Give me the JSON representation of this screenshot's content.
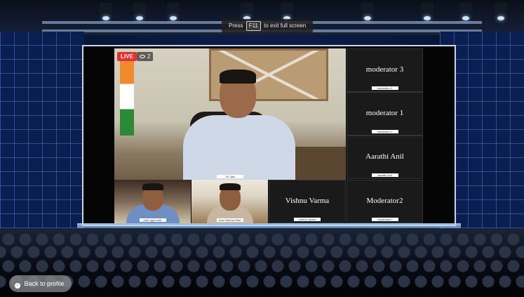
{
  "overlay": {
    "press_label": "Press",
    "key_label": "F11",
    "exit_label": "to exit full screen"
  },
  "main_video": {
    "live_badge": "LIVE",
    "viewer_count": "2",
    "viewer_icon": "eye-icon",
    "name_tag": "YK Jain"
  },
  "tiles": [
    {
      "name": "moderator 3",
      "tag": "moderator 3"
    },
    {
      "name": "moderator 1",
      "tag": "moderator 1"
    },
    {
      "name": "Aarathi Anil",
      "tag": "Aarathi Anil"
    },
    {
      "name": "Vishnu Varma",
      "tag": "Vishnu Varma"
    },
    {
      "name": "Moderator2",
      "tag": "Moderator2"
    }
  ],
  "cams": [
    {
      "tag": "prem gpd iretfr"
    },
    {
      "tag": "Arun Warrior Mba"
    }
  ],
  "back_button": {
    "label": "Back to profile",
    "icon": "back-arrow-icon"
  },
  "colors": {
    "live_red": "#e53030",
    "tile_bg": "#1a1a1a",
    "wall_blue": "#0b1e52"
  }
}
